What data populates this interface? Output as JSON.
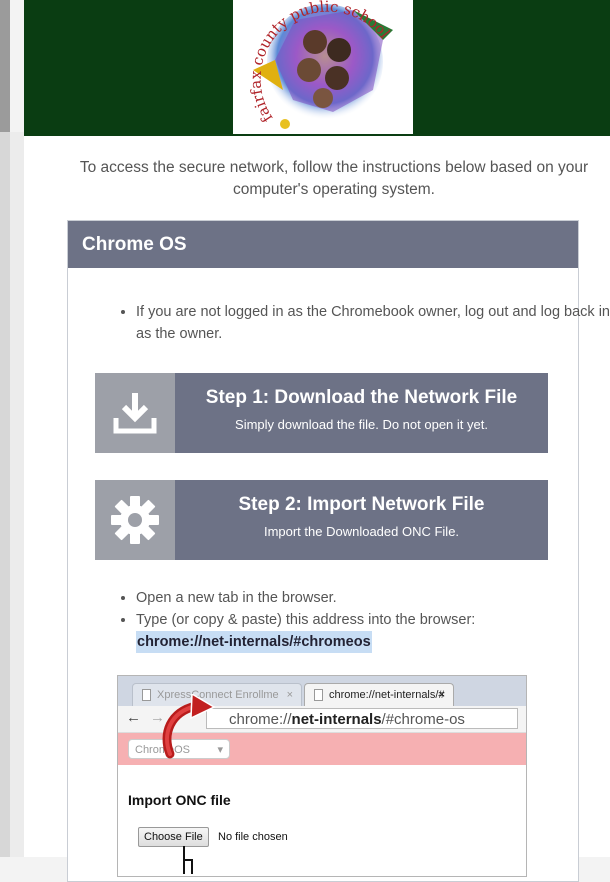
{
  "logo": {
    "text": "fairfax county public schools",
    "icon": "fcps-logo"
  },
  "intro": "To access the secure network, follow the instructions below based on your computer's operating system.",
  "panel": {
    "title": "Chrome OS",
    "bullet1": "If you are not logged in as the Chromebook owner, log out and log back in as the owner.",
    "step1": {
      "title": "Step 1: Download the Network File",
      "subtitle": "Simply download the file. Do not open it yet.",
      "icon": "download-icon"
    },
    "step2": {
      "title": "Step 2: Import Network File",
      "subtitle": "Import the Downloaded ONC File.",
      "icon": "gear-icon"
    },
    "bullet2": "Open a new tab in the browser.",
    "bullet3": "Type (or copy & paste) this address into the browser:",
    "address": "chrome://net-internals/#chromeos"
  },
  "screenshot": {
    "tab1": "XpressConnect Enrollme",
    "tab2": "chrome://net-internals/#",
    "tab_close": "×",
    "back": "←",
    "forward": "→",
    "url_prefix": "chrome://",
    "url_bold": "net-internals",
    "url_suffix": "/#chrome-os",
    "dropdown": "ChromeOS",
    "dropdown_caret": "▾",
    "heading": "Import ONC file",
    "choose_button": "Choose File",
    "no_file": "No file chosen"
  },
  "colors": {
    "header_green": "#0a3d12",
    "panel_slate": "#6d7286",
    "icon_gray": "#9da0a8",
    "highlight": "#c7ddf4",
    "pink_bar": "#f6b0b2"
  }
}
